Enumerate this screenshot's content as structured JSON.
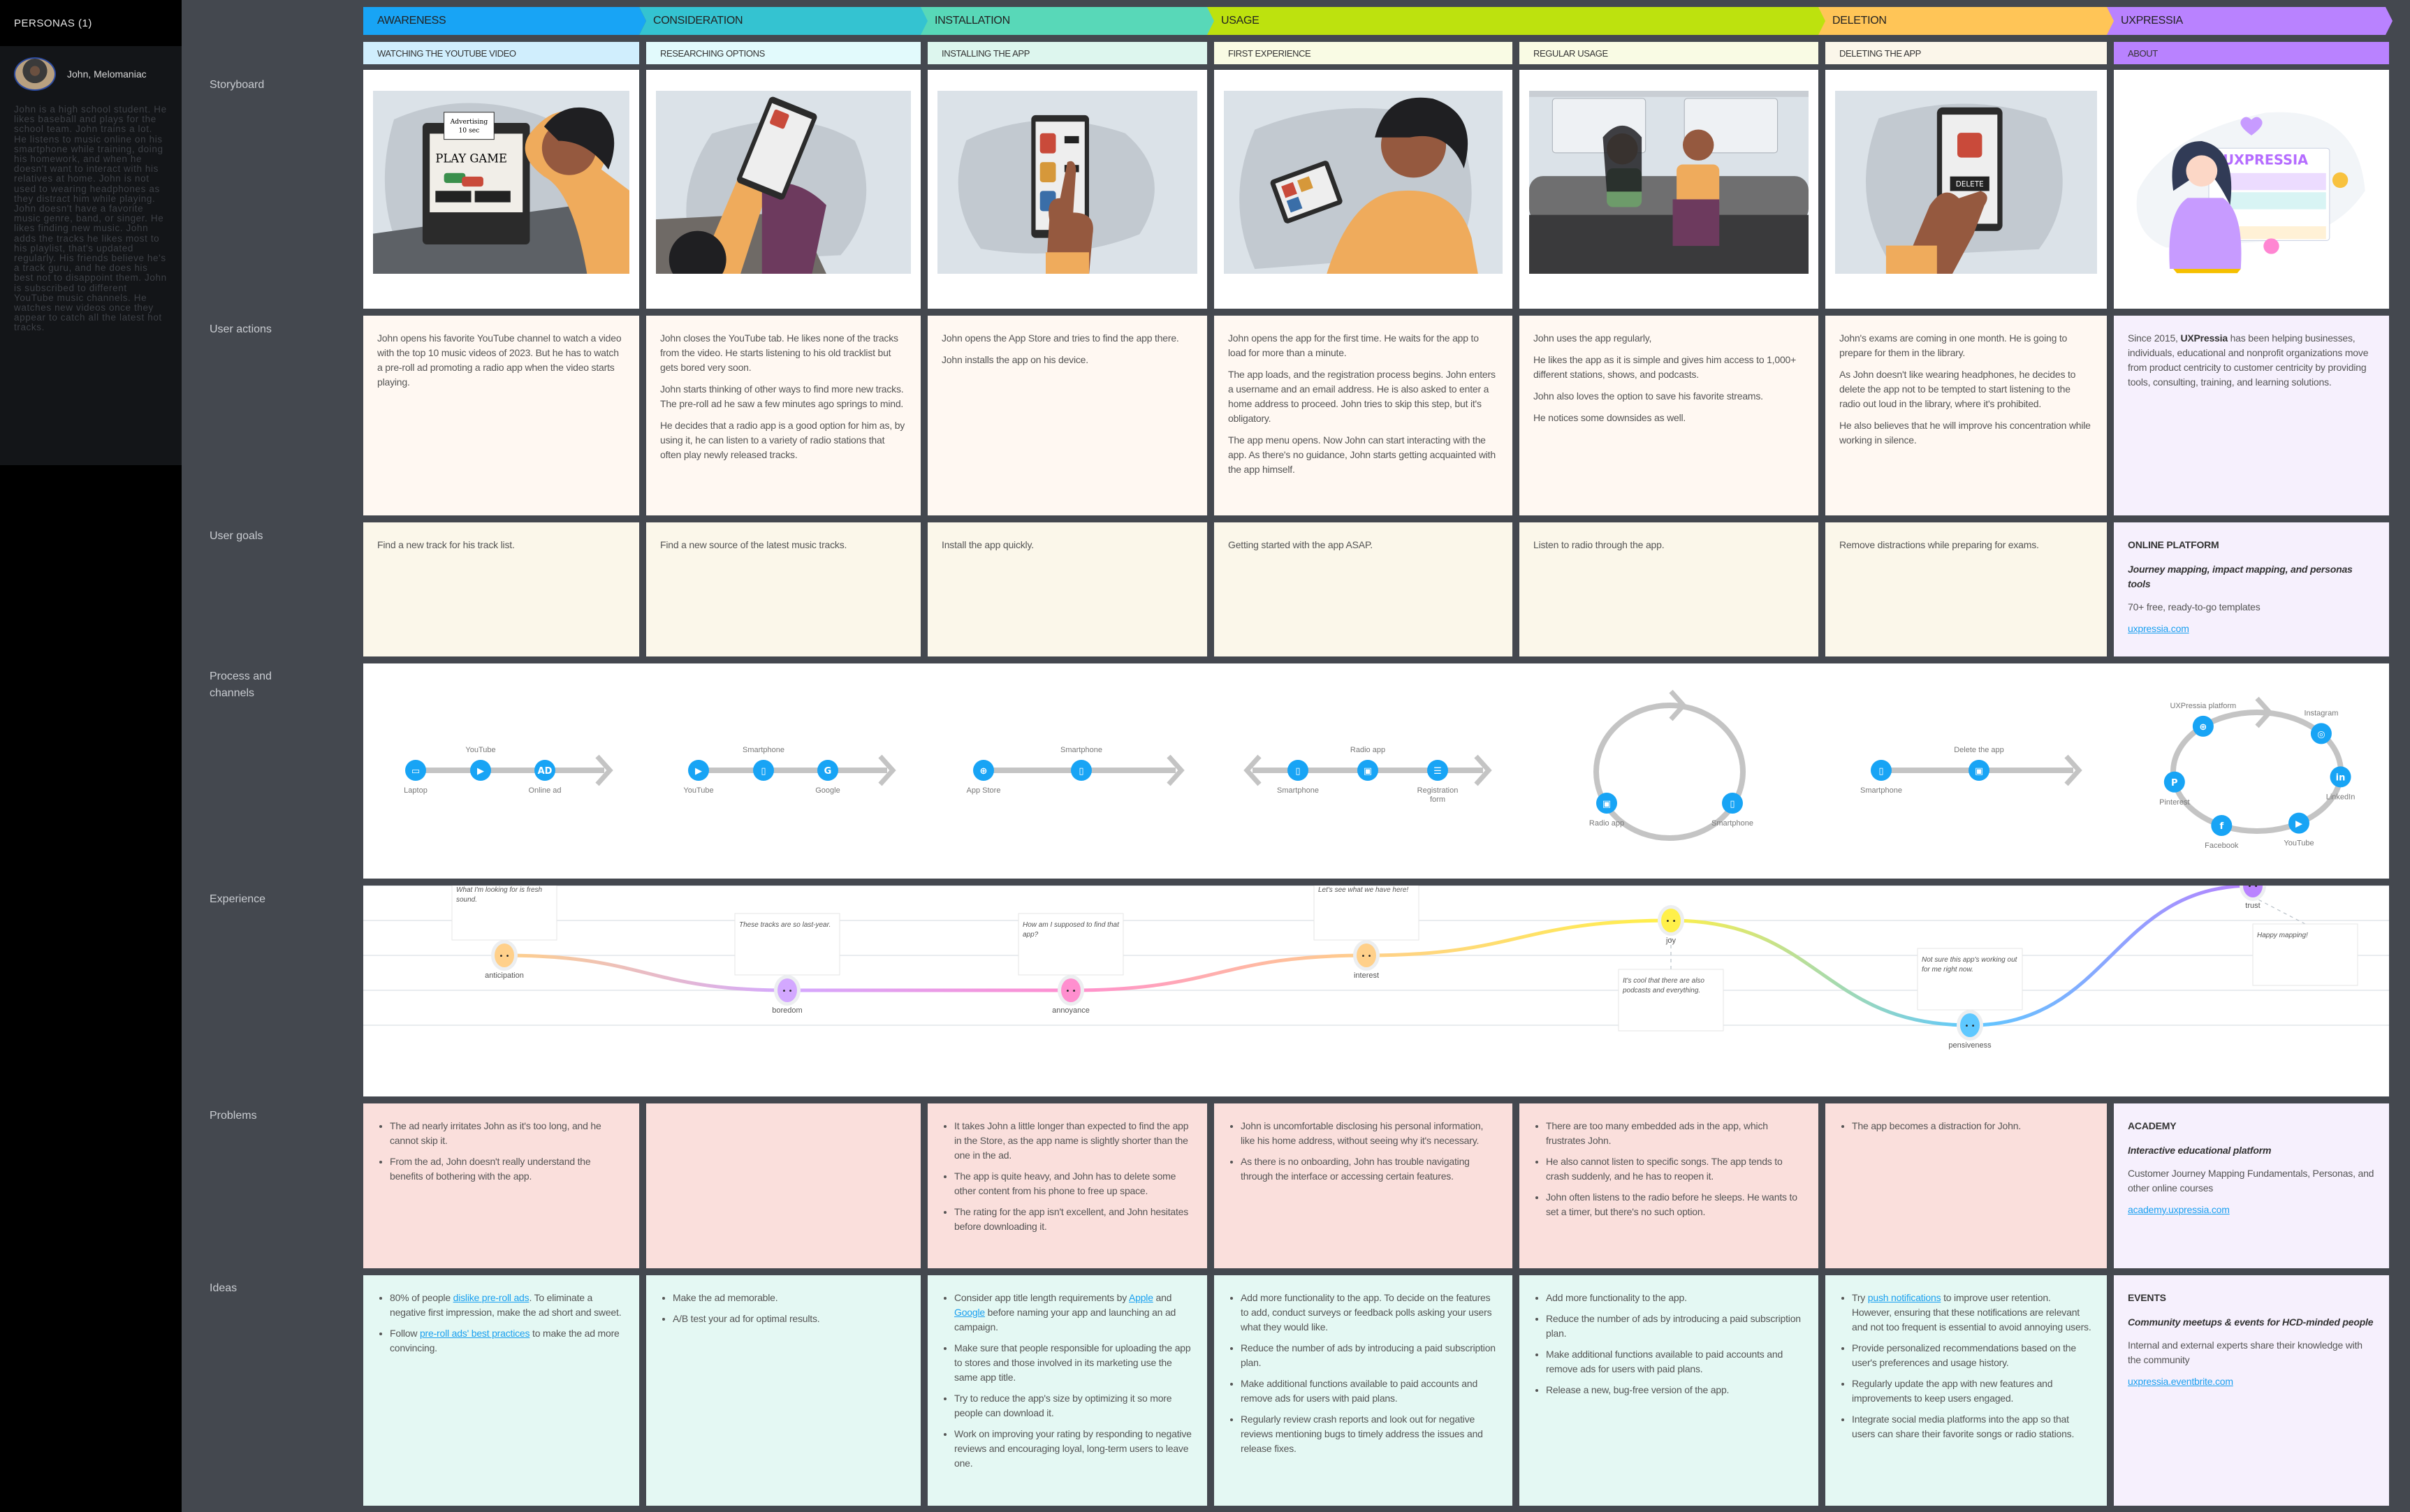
{
  "sidebar": {
    "title": "PERSONAS (1)",
    "persona": {
      "name": "John, Melomaniac",
      "description": "John is a high school student. He likes baseball and plays for the school team. John trains a lot. He listens to music online on his smartphone while training, doing his homework, and when he doesn't want to interact with his relatives at home. John is not used to wearing headphones as they distract him while playing. John doesn't have a favorite music genre, band, or singer. He likes finding new music. John adds the tracks he likes most to his playlist, that's updated regularly. His friends believe he's a track guru, and he does his best not to disappoint them. John is subscribed to different YouTube music channels. He watches new videos once they appear to catch all the latest hot tracks."
    }
  },
  "row_labels": {
    "storyboard": "Storyboard",
    "user_actions": "User actions",
    "user_goals": "User goals",
    "process": "Process and channels",
    "experience": "Experience",
    "problems": "Problems",
    "ideas": "Ideas"
  },
  "phases": [
    {
      "label": "AWARENESS",
      "color": "#18a4f5"
    },
    {
      "label": "CONSIDERATION",
      "color": "#34c3d1"
    },
    {
      "label": "INSTALLATION",
      "color": "#58d8b8"
    },
    {
      "label": "USAGE",
      "color": "#bde20e"
    },
    {
      "label": "DELETION",
      "color": "#ffc557"
    },
    {
      "label": "UXPRESSIA",
      "color": "#b982ff"
    }
  ],
  "stages": [
    {
      "label": "WATCHING THE YOUTUBE VIDEO",
      "color": "#d0eefd"
    },
    {
      "label": "RESEARCHING OPTIONS",
      "color": "#e2fafc"
    },
    {
      "label": "INSTALLING THE APP",
      "color": "#ddf6ee"
    },
    {
      "label": "FIRST EXPERIENCE",
      "color": "#f9fbe4"
    },
    {
      "label": "REGULAR USAGE",
      "color": "#f9fbe4"
    },
    {
      "label": "DELETING THE APP",
      "color": "#fbf6ea"
    },
    {
      "label": "ABOUT",
      "color": "#b982ff"
    }
  ],
  "storyboard": [
    {
      "alt": "John watching an ad on laptop",
      "ad_text": "Advertising 10 sec",
      "screen_text": "PLAY GAME"
    },
    {
      "alt": "John researching options on phone"
    },
    {
      "alt": "Installing the app"
    },
    {
      "alt": "First experience with app"
    },
    {
      "alt": "Regular usage on a bench"
    },
    {
      "alt": "Deleting the app",
      "screen_text": "DELETE"
    },
    {
      "alt": "UXPressia illustration",
      "brand": "UXPRESSIA"
    }
  ],
  "user_actions": [
    [
      "John opens his favorite YouTube channel to watch a video with the top 10 music videos of 2023. But he has to watch a pre-roll ad promoting a radio app when the video starts playing."
    ],
    [
      "John closes the YouTube tab. He likes none of the tracks from the video. He starts listening to his old tracklist but gets bored very soon.",
      "John starts thinking of other ways to find more new tracks. The pre-roll ad he saw a few minutes ago springs to mind.",
      "He decides that a radio app is a good option for him as, by using it, he can listen to a variety of radio stations that often play newly released tracks."
    ],
    [
      "John opens the App Store and tries to find the app there.",
      "John installs the app on his device."
    ],
    [
      "John opens the app for the first time. He waits for the app to load for more than a minute.",
      "The app loads, and the registration process begins. John enters a username and an email address. He is also asked to enter a home address to proceed. John tries to skip this step, but it's obligatory.",
      "The app menu opens. Now John can start interacting with the app. As there's no guidance, John starts getting acquainted with the app himself."
    ],
    [
      "John uses the app regularly,",
      "He likes the app as it is simple and gives him access to 1,000+ different stations, shows, and podcasts.",
      "John also loves the option to save his favorite streams.",
      "He notices some downsides as well."
    ],
    [
      "John's exams are coming in one month. He is going to prepare for them in the library.",
      "As John doesn't like wearing headphones, he decides to delete the app not to be tempted to start listening to the radio out loud in the library, where it's prohibited.",
      "He also believes that he will improve his concentration while working in silence."
    ],
    {
      "before": "Since 2015, ",
      "bold": "UXPressia",
      "after": " has been helping businesses, individuals, educational and nonprofit organizations move from product centricity to customer centricity by providing tools, consulting, training, and learning solutions."
    }
  ],
  "user_goals": [
    "Find a new track for his track list.",
    "Find a new source of the latest music tracks.",
    "Install the app quickly.",
    "Getting started with the app ASAP.",
    "Listen to radio through the app.",
    "Remove distractions while preparing for exams."
  ],
  "online_platform": {
    "title": "ONLINE PLATFORM",
    "subtitle": "Journey mapping, impact mapping, and personas tools",
    "text": "70+ free, ready-to-go templates",
    "link": "uxpressia.com"
  },
  "process": [
    {
      "type": "line",
      "nodes": [
        {
          "icon": "laptop-icon",
          "label": "Laptop",
          "pos": "below"
        },
        {
          "icon": "youtube-icon",
          "label": "YouTube",
          "pos": "above"
        },
        {
          "icon": "ad-icon",
          "label": "Online ad",
          "pos": "below"
        }
      ]
    },
    {
      "type": "line",
      "nodes": [
        {
          "icon": "youtube-icon",
          "label": "YouTube",
          "pos": "below"
        },
        {
          "icon": "smartphone-icon",
          "label": "Smartphone",
          "pos": "above"
        },
        {
          "icon": "google-icon",
          "label": "Google",
          "pos": "below"
        }
      ]
    },
    {
      "type": "line",
      "nodes": [
        {
          "icon": "globe-icon",
          "label": "App Store",
          "pos": "below"
        },
        {
          "icon": "smartphone-icon",
          "label": "Smartphone",
          "pos": "above"
        }
      ]
    },
    {
      "type": "both",
      "nodes": [
        {
          "icon": "smartphone-icon",
          "label": "Smartphone",
          "pos": "below"
        },
        {
          "icon": "radio-app-icon",
          "label": "Radio app",
          "pos": "above"
        },
        {
          "icon": "form-icon",
          "label": "Registration form",
          "pos": "below"
        }
      ]
    },
    {
      "type": "circle",
      "nodes": [
        {
          "icon": "radio-app-icon",
          "label": "Radio app"
        },
        {
          "icon": "smartphone-icon",
          "label": "Smartphone"
        }
      ]
    },
    {
      "type": "line",
      "nodes": [
        {
          "icon": "smartphone-icon",
          "label": "Smartphone",
          "pos": "below"
        },
        {
          "icon": "radio-app-icon",
          "label": "Delete the app",
          "pos": "above"
        }
      ]
    },
    {
      "type": "circle6",
      "nodes": [
        {
          "icon": "globe-icon",
          "label": "UXPressia platform"
        },
        {
          "icon": "instagram-icon",
          "label": "Instagram"
        },
        {
          "icon": "linkedin-icon",
          "label": "LinkedIn"
        },
        {
          "icon": "youtube-icon",
          "label": "YouTube"
        },
        {
          "icon": "facebook-icon",
          "label": "Facebook"
        },
        {
          "icon": "pinterest-icon",
          "label": "Pinterest"
        }
      ]
    }
  ],
  "experience": {
    "points": [
      {
        "emotion": "anticipation",
        "level": 3,
        "color": "#ffd08a",
        "quote": "What I'm looking for is fresh sound.",
        "quote_pos": "above"
      },
      {
        "emotion": "boredom",
        "level": 2,
        "color": "#d3a8ff",
        "quote": "These tracks are so last-year.",
        "quote_pos": "above"
      },
      {
        "emotion": "annoyance",
        "level": 2,
        "color": "#ff8fcf",
        "quote": "How am I supposed to find that app?",
        "quote_pos": "above"
      },
      {
        "emotion": "interest",
        "level": 3,
        "color": "#ffd08a",
        "quote": "Let's see what we have here!",
        "quote_pos": "above"
      },
      {
        "emotion": "joy",
        "level": 4,
        "color": "#fff04a",
        "quote": "It's cool that there are also podcasts and everything.",
        "quote_pos": "below"
      },
      {
        "emotion": "pensiveness",
        "level": 1,
        "color": "#5ec8ff",
        "quote": "Not sure this app's working out for me right now.",
        "quote_pos": "above"
      },
      {
        "emotion": "trust",
        "level": 5,
        "color": "#b982ff",
        "quote": "Happy mapping!",
        "quote_pos": "below-right"
      }
    ],
    "scale_max": 5
  },
  "problems": [
    [
      "The ad nearly irritates John as it's too long, and he cannot skip it.",
      "From the ad, John doesn't really understand the benefits of bothering with the app."
    ],
    [],
    [
      "It takes John a little longer than expected to find the app in the Store, as the app name is slightly shorter than the one in the ad.",
      "The app is quite heavy, and John has to delete some other content from his phone to free up space.",
      "The rating for the app isn't excellent, and John hesitates before downloading it."
    ],
    [
      "John is uncomfortable disclosing his personal information, like his home address, without seeing why it's necessary.",
      "As there is no onboarding, John has trouble navigating through the interface or accessing certain features."
    ],
    [
      "There are too many embedded ads in the app, which frustrates John.",
      "He also cannot listen to specific songs. The app tends to crash suddenly, and he has to reopen it.",
      "John often listens to the radio before he sleeps. He wants to set a timer, but there's no such option."
    ],
    [
      "The app becomes a distraction for John."
    ]
  ],
  "academy": {
    "title": "ACADEMY",
    "subtitle": "Interactive educational platform",
    "text": "Customer Journey Mapping Fundamentals, Personas, and other online courses",
    "link": "academy.uxpressia.com"
  },
  "ideas": [
    [
      {
        "parts": [
          "80% of people ",
          {
            "link": "dislike pre-roll ads"
          },
          ". To eliminate a negative first impression, make the ad short and sweet."
        ]
      },
      {
        "parts": [
          "Follow ",
          {
            "link": "pre-roll ads' best practices"
          },
          " to make the ad more convincing."
        ]
      }
    ],
    [
      {
        "parts": [
          "Make the ad memorable."
        ]
      },
      {
        "parts": [
          "A/B test your ad for optimal results."
        ]
      }
    ],
    [
      {
        "parts": [
          "Consider app title length requirements by ",
          {
            "link": "Apple"
          },
          " and ",
          {
            "link": "Google"
          },
          " before naming your app and launching an ad campaign."
        ]
      },
      {
        "parts": [
          "Make sure that people responsible for uploading the app to stores and those involved in its marketing use the same app title."
        ]
      },
      {
        "parts": [
          "Try to reduce the app's size by optimizing it so more people can download it."
        ]
      },
      {
        "parts": [
          "Work on improving your rating by responding to negative reviews and encouraging loyal, long-term users to leave one."
        ]
      }
    ],
    [
      {
        "parts": [
          "Add more functionality to the app. To decide on the features to add, conduct surveys or feedback polls asking your users what they would like."
        ]
      },
      {
        "parts": [
          "Reduce the number of ads by introducing a paid subscription plan."
        ]
      },
      {
        "parts": [
          "Make additional functions available to paid accounts and remove ads for users with paid plans."
        ]
      },
      {
        "parts": [
          "Regularly review crash reports and look out for negative reviews mentioning bugs to timely address the issues and release fixes."
        ]
      }
    ],
    [
      {
        "parts": [
          "Add more functionality to the app."
        ]
      },
      {
        "parts": [
          "Reduce the number of ads by introducing a paid subscription plan."
        ]
      },
      {
        "parts": [
          "Make additional functions available to paid accounts and remove ads for users with paid plans."
        ]
      },
      {
        "parts": [
          "Release a new, bug-free version of the app."
        ]
      }
    ],
    [
      {
        "parts": [
          "Try ",
          {
            "link": "push notifications"
          },
          " to improve user retention. However, ensuring that these notifications are relevant and not too frequent is essential to avoid annoying users."
        ]
      },
      {
        "parts": [
          "Provide personalized recommendations based on the user's preferences and usage history."
        ]
      },
      {
        "parts": [
          "Regularly update the app with new features and improvements to keep users engaged."
        ]
      },
      {
        "parts": [
          "Integrate social media platforms into the app so that users can share their favorite songs or radio stations."
        ]
      }
    ]
  ],
  "events": {
    "title": "EVENTS",
    "subtitle": "Community meetups & events for HCD-minded people",
    "text": "Internal and external experts share their knowledge with the community",
    "link": "uxpressia.eventbrite.com"
  },
  "colors": {
    "actions_bg": "#fff8f2",
    "goals_bg": "#fbf7ea",
    "problems_bg": "#fadfdc",
    "ideas_bg": "#e4f8f3",
    "uxp_bg": "#f6f0fd",
    "node_blue": "#18a4f5",
    "track_gray": "#c4c4c4",
    "link": "#1aa0f0"
  }
}
